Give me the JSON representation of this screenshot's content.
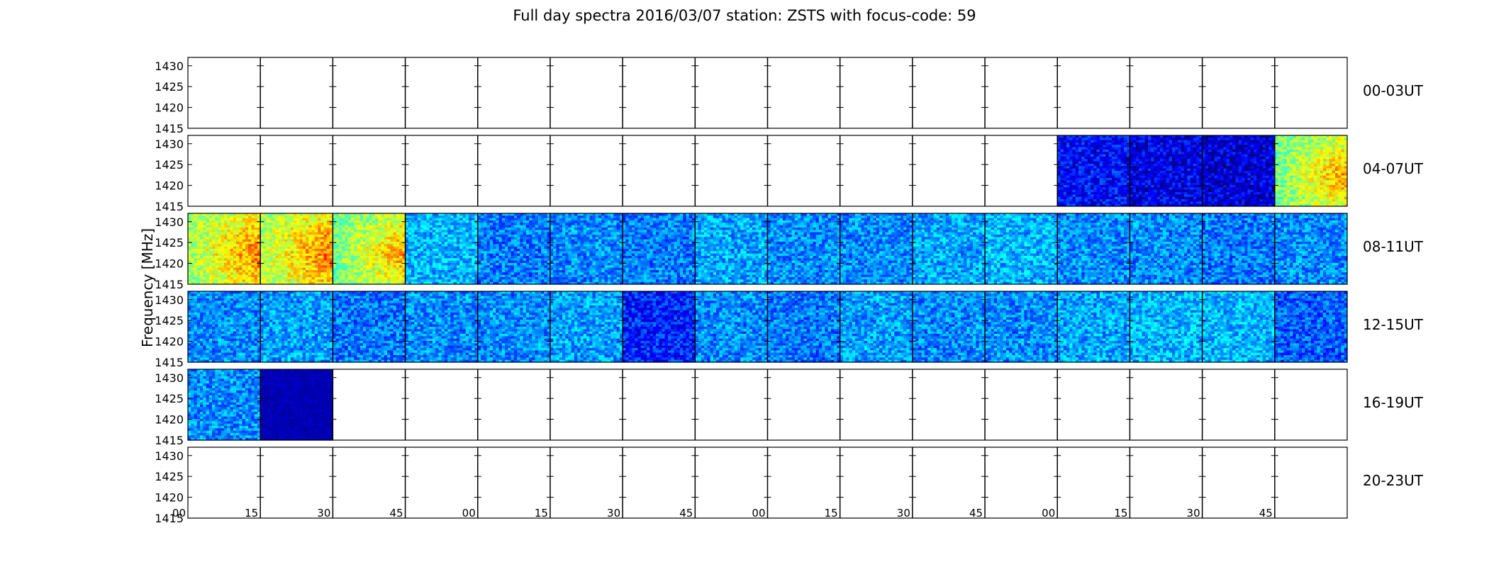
{
  "title": "Full day spectra 2016/03/07 station: ZSTS with focus-code: 59",
  "colors": {
    "axes": "#000000",
    "background": "#ffffff",
    "colormap": [
      "#00007f",
      "#0000ff",
      "#007fff",
      "#00ffff",
      "#7fff7f",
      "#ffff00",
      "#ff7f00",
      "#ff0000"
    ]
  },
  "chart_data": {
    "type": "heatmap",
    "title": "Full day spectra 2016/03/07 station: ZSTS with focus-code: 59",
    "ylabel": "Frequency [MHz]",
    "xlabel": "",
    "ylim": [
      1415,
      1432
    ],
    "yticks": [
      1415,
      1420,
      1425,
      1430
    ],
    "xtick_labels": [
      "00",
      "15",
      "30",
      "45",
      "00",
      "15",
      "30",
      "45",
      "00",
      "15",
      "30",
      "45",
      "00",
      "15",
      "30",
      "45"
    ],
    "colormap": "jet",
    "rows": [
      {
        "label": "00-03UT",
        "panels": [
          0,
          0,
          0,
          0,
          0,
          0,
          0,
          0,
          0,
          0,
          0,
          0,
          0,
          0,
          0,
          0
        ]
      },
      {
        "label": "04-07UT",
        "panels": [
          0,
          0,
          0,
          0,
          0,
          0,
          0,
          0,
          0,
          0,
          0,
          0,
          0.15,
          0.12,
          0.1,
          0.55
        ]
      },
      {
        "label": "08-11UT",
        "panels": [
          0.6,
          0.62,
          0.55,
          0.35,
          0.28,
          0.3,
          0.28,
          0.33,
          0.3,
          0.3,
          0.33,
          0.35,
          0.3,
          0.3,
          0.28,
          0.3
        ]
      },
      {
        "label": "12-15UT",
        "panels": [
          0.3,
          0.32,
          0.28,
          0.3,
          0.3,
          0.32,
          0.18,
          0.3,
          0.28,
          0.32,
          0.3,
          0.3,
          0.33,
          0.35,
          0.35,
          0.25
        ]
      },
      {
        "label": "16-19UT",
        "panels": [
          0.3,
          0.06,
          0,
          0,
          0,
          0,
          0,
          0,
          0,
          0,
          0,
          0,
          0,
          0,
          0,
          0
        ]
      },
      {
        "label": "20-23UT",
        "panels": [
          0,
          0,
          0,
          0,
          0,
          0,
          0,
          0,
          0,
          0,
          0,
          0,
          0,
          0,
          0,
          0
        ]
      }
    ]
  }
}
